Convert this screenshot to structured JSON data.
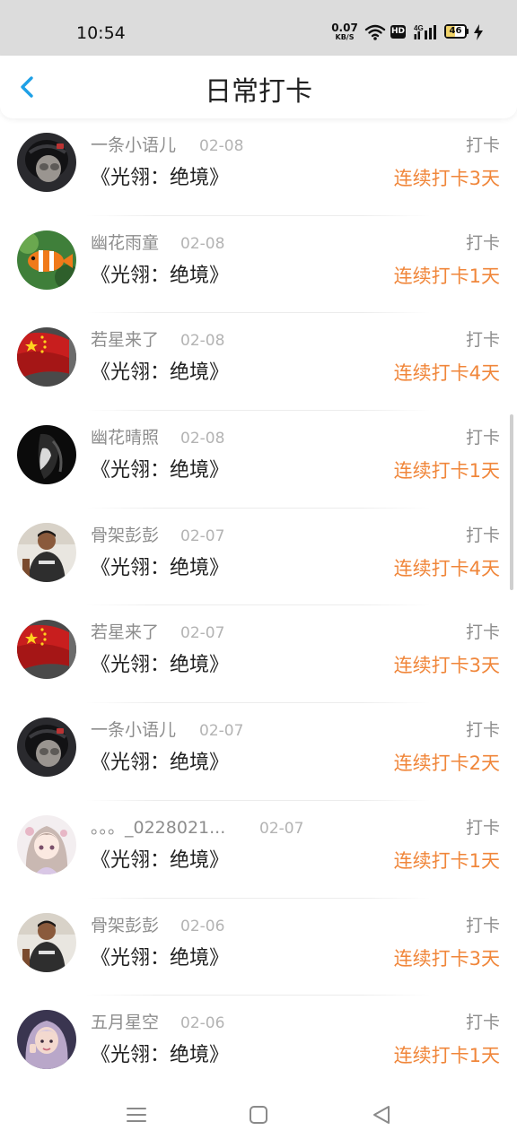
{
  "status_bar": {
    "time": "10:54",
    "net_speed_value": "0.07",
    "net_speed_unit": "KB/S",
    "hd_label": "HD",
    "network_label": "4G",
    "battery_level": "46",
    "battery_fraction": 0.46,
    "icons": [
      "wifi-icon",
      "hd-icon",
      "signal-icon",
      "battery-icon",
      "charging-icon"
    ]
  },
  "header": {
    "title": "日常打卡",
    "back_icon": "chevron-left-icon"
  },
  "colors": {
    "accent_blue": "#1ea0e6",
    "streak_orange": "#f0863a",
    "name_gray": "#8d8d8d",
    "date_gray": "#b3b3b3"
  },
  "checkins": [
    {
      "user": "一条小语儿",
      "date": "02-08",
      "type": "打卡",
      "book": "《光翎：绝境》",
      "streak": "连续打卡3天",
      "avatar": "avatar-cat-helmet"
    },
    {
      "user": "幽花雨童",
      "date": "02-08",
      "type": "打卡",
      "book": "《光翎：绝境》",
      "streak": "连续打卡1天",
      "avatar": "avatar-clownfish"
    },
    {
      "user": "若星来了",
      "date": "02-08",
      "type": "打卡",
      "book": "《光翎：绝境》",
      "streak": "连续打卡4天",
      "avatar": "avatar-flag"
    },
    {
      "user": "幽花晴照",
      "date": "02-08",
      "type": "打卡",
      "book": "《光翎：绝境》",
      "streak": "连续打卡1天",
      "avatar": "avatar-dark-figure"
    },
    {
      "user": "骨架彭彭",
      "date": "02-07",
      "type": "打卡",
      "book": "《光翎：绝境》",
      "streak": "连续打卡4天",
      "avatar": "avatar-man-photo"
    },
    {
      "user": "若星来了",
      "date": "02-07",
      "type": "打卡",
      "book": "《光翎：绝境》",
      "streak": "连续打卡3天",
      "avatar": "avatar-flag"
    },
    {
      "user": "一条小语儿",
      "date": "02-07",
      "type": "打卡",
      "book": "《光翎：绝境》",
      "streak": "连续打卡2天",
      "avatar": "avatar-cat-helmet"
    },
    {
      "user": "。。。_0228021...",
      "date": "02-07",
      "type": "打卡",
      "book": "《光翎：绝境》",
      "streak": "连续打卡1天",
      "avatar": "avatar-anime-girl"
    },
    {
      "user": "骨架彭彭",
      "date": "02-06",
      "type": "打卡",
      "book": "《光翎：绝境》",
      "streak": "连续打卡3天",
      "avatar": "avatar-man-photo"
    },
    {
      "user": "五月星空",
      "date": "02-06",
      "type": "打卡",
      "book": "《光翎：绝境》",
      "streak": "连续打卡1天",
      "avatar": "avatar-girl-photo"
    }
  ],
  "nav_bar": {
    "icons": [
      "menu-icon",
      "home-icon",
      "back-triangle-icon"
    ]
  }
}
